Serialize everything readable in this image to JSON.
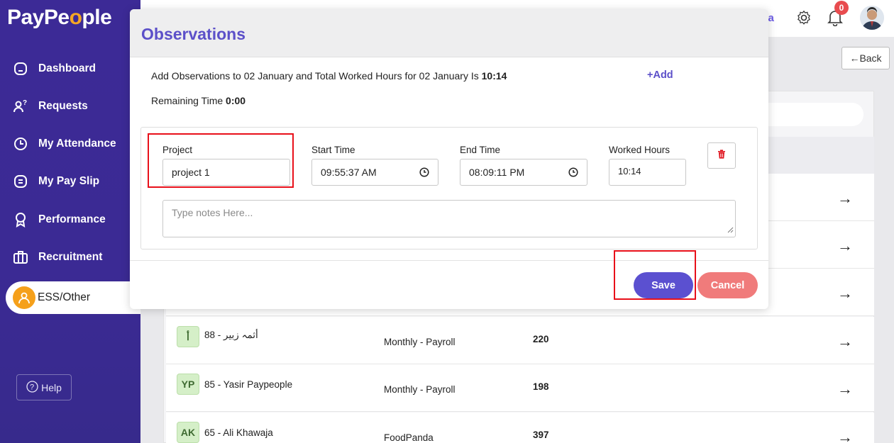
{
  "app": {
    "logo": "PayPe",
    "logo_o": "o",
    "logo_end": "ple"
  },
  "sidebar": {
    "items": [
      {
        "label": "Dashboard",
        "icon": "home-icon"
      },
      {
        "label": "Requests",
        "icon": "request-user-icon"
      },
      {
        "label": "My Attendance",
        "icon": "clock-icon"
      },
      {
        "label": "My Pay Slip",
        "icon": "document-icon"
      },
      {
        "label": "Performance",
        "icon": "award-icon"
      },
      {
        "label": "Recruitment",
        "icon": "briefcase-icon"
      },
      {
        "label": "ESS/Other",
        "icon": "user-icon",
        "active": true
      }
    ],
    "help_label": "Help"
  },
  "topbar": {
    "partial_text": "ica",
    "notification_count": "0"
  },
  "back_label": "Back",
  "rows": [
    {
      "avatar": "أ",
      "name": "88 - أثمہ زبیر",
      "group": "Monthly - Payroll",
      "value": "220"
    },
    {
      "avatar": "YP",
      "name": "85 - Yasir Paypeople",
      "group": "Monthly - Payroll",
      "value": "198"
    },
    {
      "avatar": "AK",
      "name": "65 - Ali Khawaja",
      "group": "FoodPanda",
      "value": "397"
    }
  ],
  "modal": {
    "title": "Observations",
    "info_prefix": "Add Observations to 02 January and Total Worked Hours for 02 January Is ",
    "info_hours": "10:14",
    "add_label": "+Add",
    "remaining_prefix": "Remaining Time ",
    "remaining_value": "0:00",
    "fields": {
      "project_label": "Project",
      "project_value": "project 1",
      "start_label": "Start Time",
      "start_value": "09:55:37 AM",
      "end_label": "End Time",
      "end_value": "08:09:11 PM",
      "worked_label": "Worked Hours",
      "worked_value": "10:14"
    },
    "notes_placeholder": "Type notes Here...",
    "save_label": "Save",
    "cancel_label": "Cancel"
  },
  "colors": {
    "sidebar": "#3c2a96",
    "accent": "#5b50d0",
    "cancel": "#f07b7b",
    "highlight": "#e8101a"
  }
}
